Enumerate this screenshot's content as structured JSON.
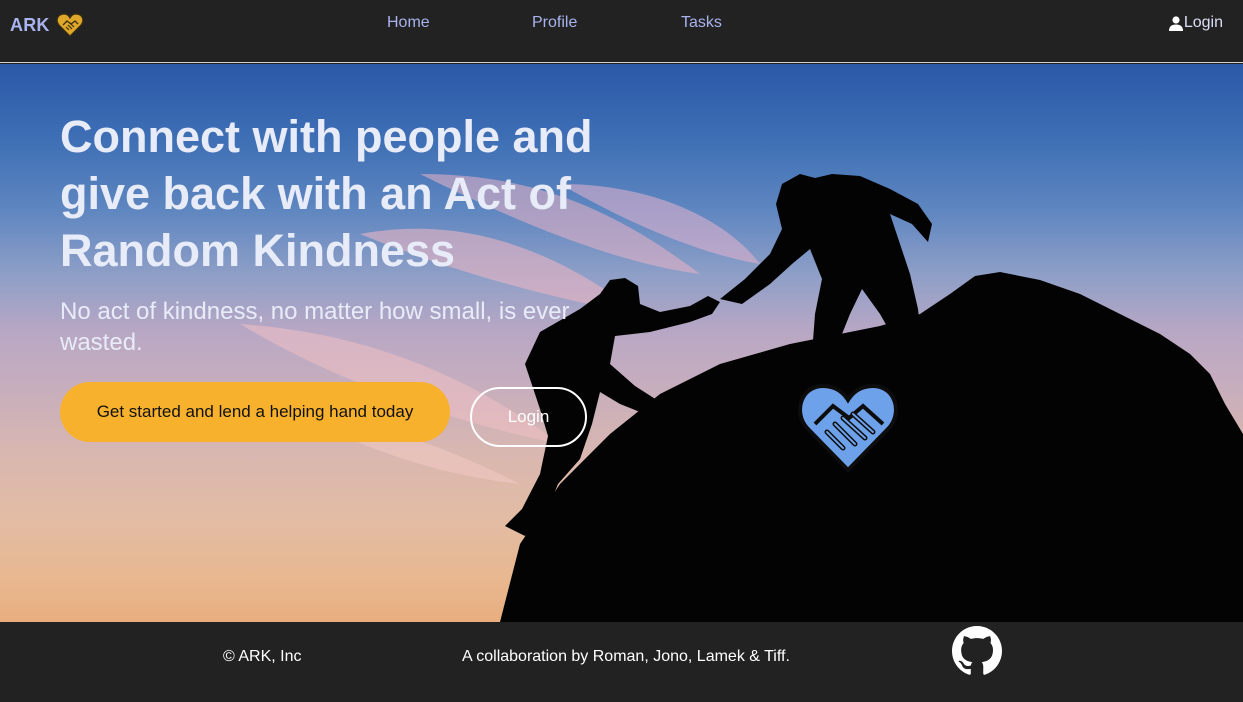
{
  "navbar": {
    "brand": "ARK",
    "links": [
      "Home",
      "Profile",
      "Tasks"
    ],
    "login_label": "Login"
  },
  "hero": {
    "title": "Connect with people and give back with an Act of Random Kindness",
    "subtitle": "No act of kindness, no matter how small, is ever wasted.",
    "primary_button": "Get started and lend a helping hand today",
    "secondary_button": "Login"
  },
  "footer": {
    "copyright": "© ARK, Inc",
    "collaboration": "A collaboration by Roman, Jono, Lamek & Tiff."
  },
  "icons": {
    "brand_logo": "heart-handshake-icon",
    "user": "user-icon",
    "emblem": "heart-handshake-icon",
    "github": "github-icon"
  },
  "colors": {
    "navbar_bg": "#222222",
    "nav_link": "#a9b3ee",
    "accent": "#f8b12c",
    "emblem_fill": "#6da1ea",
    "footer_bg": "#222222"
  }
}
